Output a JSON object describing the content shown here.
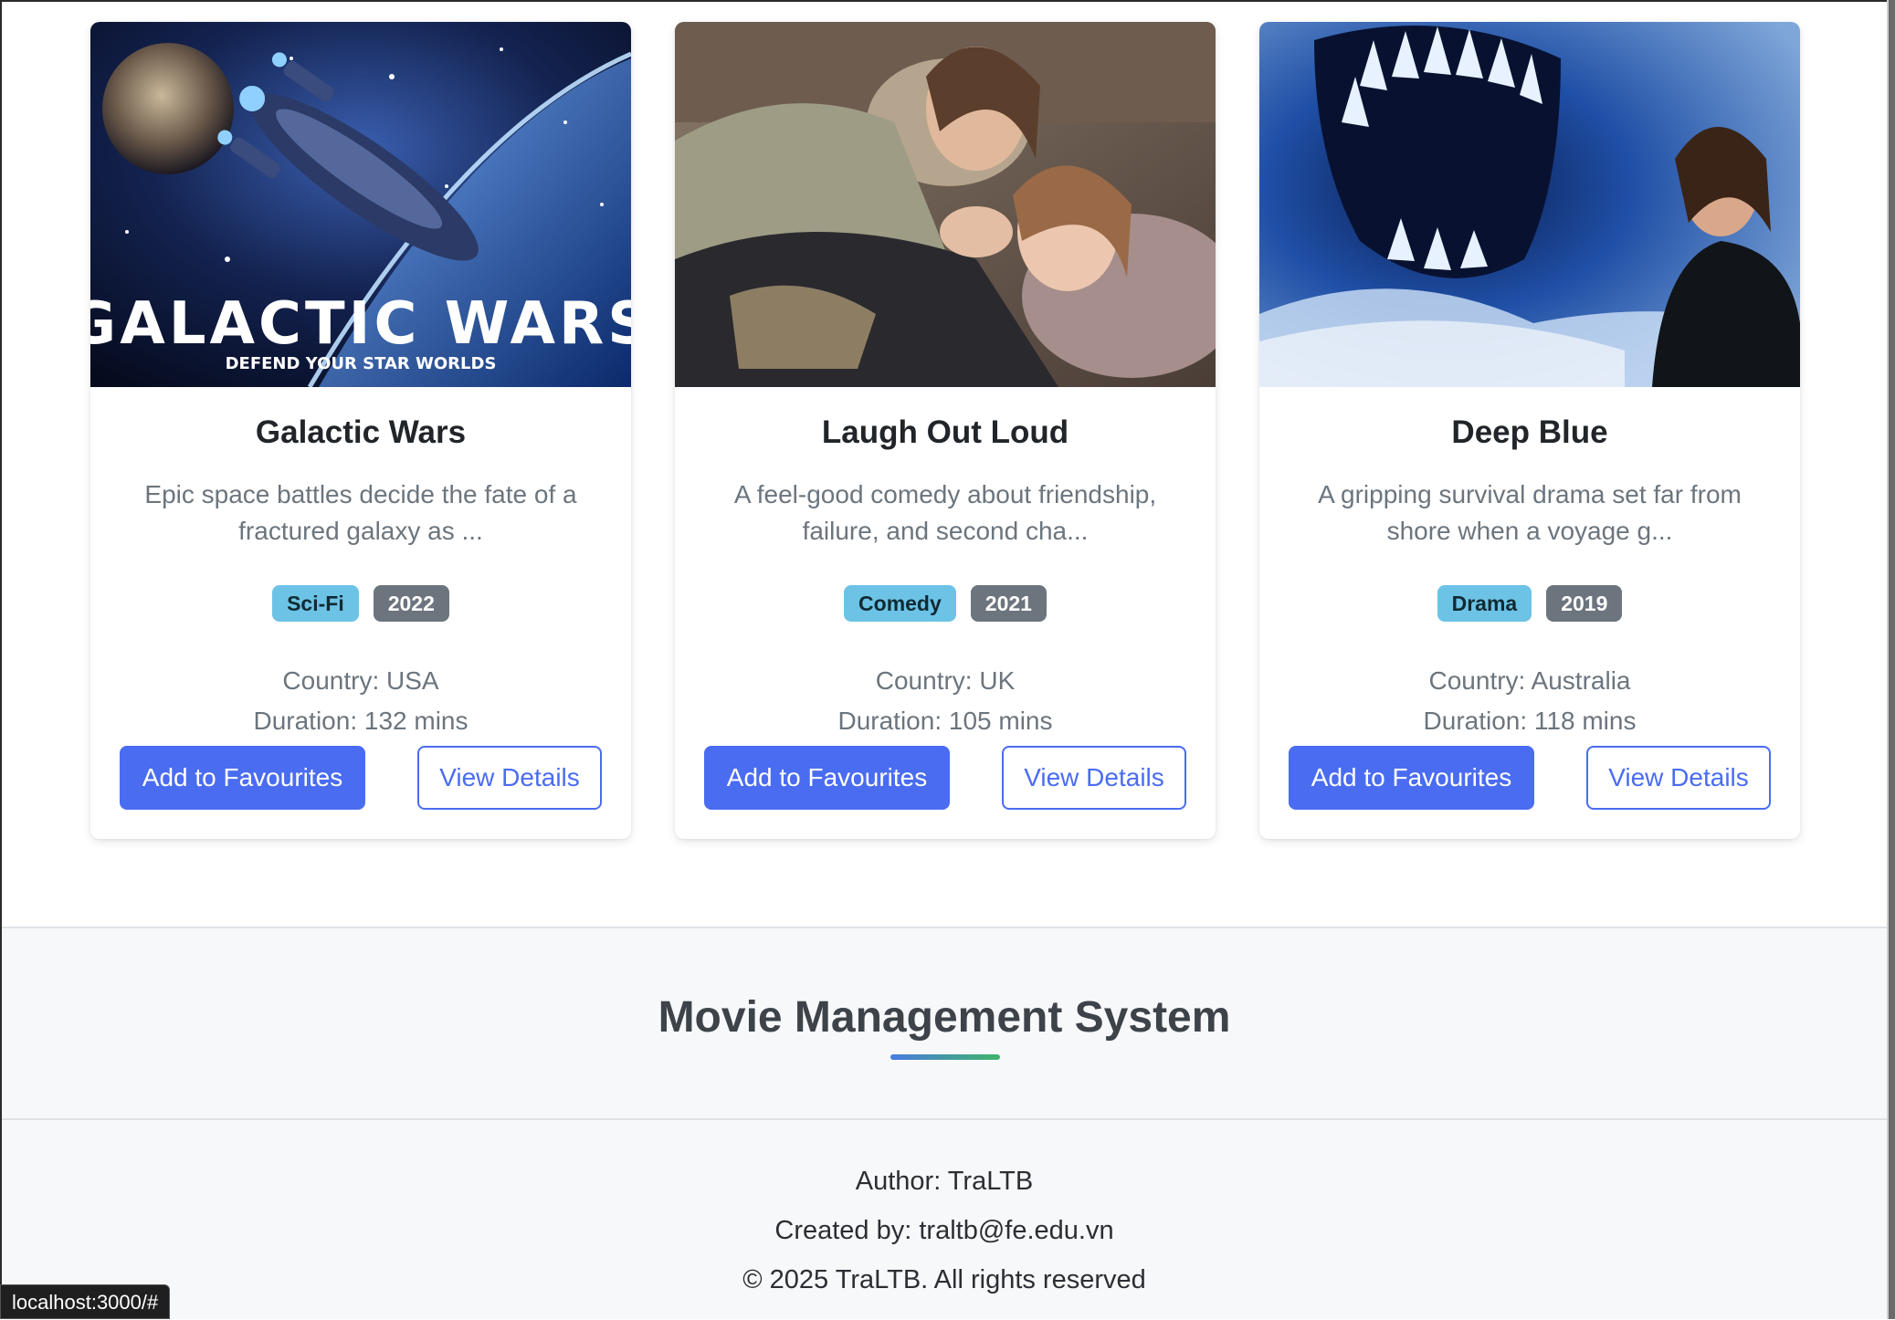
{
  "movies": [
    {
      "title": "Galactic Wars",
      "description": "Epic space battles decide the fate of a fractured galaxy as ...",
      "genre": "Sci-Fi",
      "year": "2022",
      "country": "Country: USA",
      "duration": "Duration: 132 mins",
      "poster_text": "GALACTIC WARS",
      "poster_subtext": "DEFEND YOUR STAR WORLDS",
      "add_label": "Add to Favourites",
      "details_label": "View Details"
    },
    {
      "title": "Laugh Out Loud",
      "description": "A feel-good comedy about friendship, failure, and second cha...",
      "genre": "Comedy",
      "year": "2021",
      "country": "Country: UK",
      "duration": "Duration: 105 mins",
      "add_label": "Add to Favourites",
      "details_label": "View Details"
    },
    {
      "title": "Deep Blue",
      "description": "A gripping survival drama set far from shore when a voyage g...",
      "genre": "Drama",
      "year": "2019",
      "country": "Country: Australia",
      "duration": "Duration: 118 mins",
      "add_label": "Add to Favourites",
      "details_label": "View Details"
    }
  ],
  "footer": {
    "title": "Movie Management System",
    "author": "Author: TraLTB",
    "created_by": "Created by: traltb@fe.edu.vn",
    "copyright": "© 2025 TraLTB. All rights reserved"
  },
  "status_bar": {
    "url": "localhost:3000/#"
  },
  "colors": {
    "primary": "#4a6cf1",
    "genre_badge": "#6cc3e6",
    "year_badge": "#6c757d",
    "footer_bg": "#f7f8fa"
  }
}
